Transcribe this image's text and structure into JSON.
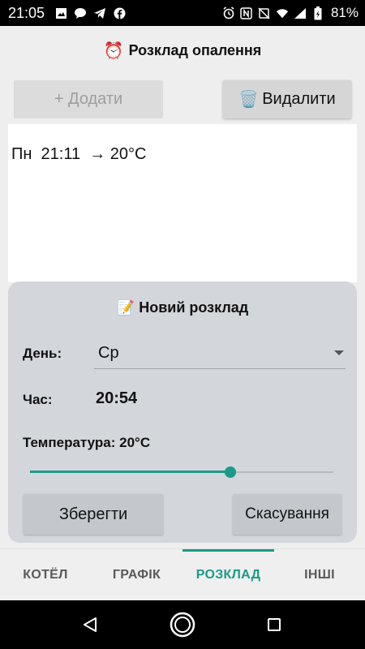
{
  "status_bar": {
    "time": "21:05",
    "battery_text": "81%",
    "left_icons": [
      "image-icon",
      "chat-bubble-icon",
      "telegram-icon",
      "facebook-icon"
    ],
    "right_icons": [
      "alarm-icon",
      "nfc-icon",
      "nfc-off-icon",
      "wifi-icon",
      "signal-icon",
      "battery-icon"
    ]
  },
  "header": {
    "icon": "⏰",
    "title": "Розклад опалення"
  },
  "toolbar": {
    "add_label": "+ Додати",
    "delete_icon": "🗑️",
    "delete_label": "Видалити"
  },
  "schedule": {
    "items": [
      {
        "text": "Пн  21:11  → 20°C"
      }
    ]
  },
  "dialog": {
    "icon": "📝",
    "title": "Новий розклад",
    "day_label": "День:",
    "day_value": "Ср",
    "time_label": "Час:",
    "time_value": "20:54",
    "temp_label": "Температура: 20°C",
    "temp_slider_fraction": 0.66,
    "save_label": "Зберегти",
    "cancel_label": "Скасування"
  },
  "tabs": [
    {
      "label": "КОТЁЛ",
      "active": false
    },
    {
      "label": "ГРАФІК",
      "active": false
    },
    {
      "label": "РОЗКЛАД",
      "active": true
    },
    {
      "label": "ІНШІ",
      "active": false
    }
  ],
  "colors": {
    "accent": "#1b9a8a",
    "status_bar_bg": "#000000",
    "dialog_bg": "#d3d6da"
  }
}
